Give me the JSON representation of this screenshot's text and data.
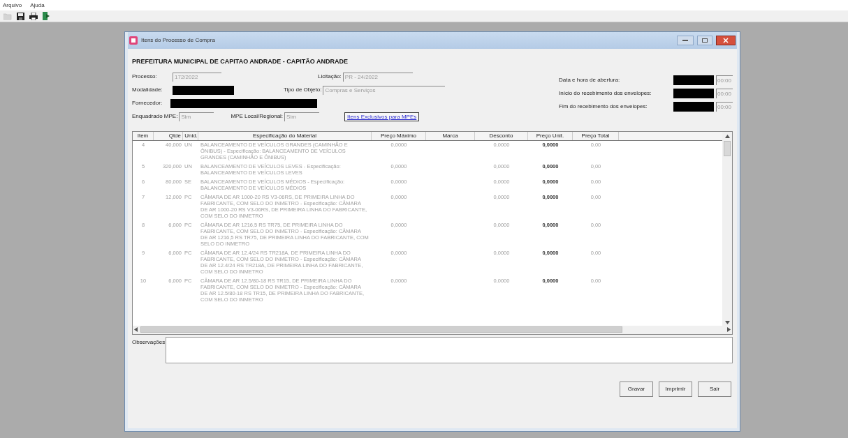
{
  "menu": [
    "Arquivo",
    "Ajuda"
  ],
  "toolbar": [
    {
      "kind": "open",
      "disabled": true
    },
    {
      "kind": "save",
      "disabled": false
    },
    {
      "kind": "print",
      "disabled": false
    },
    {
      "kind": "exit",
      "disabled": false
    }
  ],
  "window": {
    "title": "Itens do Processo de Compra"
  },
  "heading": "PREFEITURA MUNICIPAL DE CAPITAO ANDRADE - CAPITÃO ANDRADE",
  "fields": {
    "processo": {
      "label": "Processo:",
      "value": "172/2022"
    },
    "licitacao": {
      "label": "Licitação:",
      "value": "PR - 24/2022"
    },
    "modalidade": {
      "label": "Modalidade:",
      "redacted": true
    },
    "tipo_objeto": {
      "label": "Tipo de Objeto:",
      "value": "Compras e Serviços"
    },
    "fornecedor": {
      "label": "Fornecedor:",
      "redacted": true
    },
    "enquadrado_mpe": {
      "label": "Enquadrado MPE:",
      "value": "Sim"
    },
    "mpe_local": {
      "label": "MPE Local/Regional:",
      "value": "Sim"
    }
  },
  "mpe_button": "Itens Exclusivos para MPEs",
  "dates": [
    {
      "label": "Data e hora de abertura:",
      "redacted": true,
      "time": "00:00"
    },
    {
      "label": "Início do recebimento dos envelopes:",
      "redacted": true,
      "time": "00:00"
    },
    {
      "label": "Fim do recebimento dos envelopes:",
      "redacted": true,
      "time": "00:00"
    }
  ],
  "table": {
    "columns": [
      "Item",
      "Qtde",
      "Unid.",
      "Especificação do Material",
      "Preço Máximo",
      "Marca",
      "Desconto",
      "Preço Unit.",
      "Preço Total"
    ],
    "rows": [
      {
        "item": "4",
        "qtde": "40,000",
        "unid": "UN",
        "spec": "BALANCEAMENTO DE VEÍCULOS GRANDES (CAMINHÃO E ÔNIBUS) - Especificação: BALANCEAMENTO DE VEÍCULOS GRANDES (CAMINHÃO E ÔNIBUS)",
        "max": "0,0000",
        "marca": "",
        "desconto": "0,0000",
        "unit": "0,0000",
        "total": "0,00"
      },
      {
        "item": "5",
        "qtde": "320,000",
        "unid": "UN",
        "spec": "BALANCEAMENTO DE VEÍCULOS LEVES - Especificação: BALANCEAMENTO DE VEÍCULOS LEVES",
        "max": "0,0000",
        "marca": "",
        "desconto": "0,0000",
        "unit": "0,0000",
        "total": "0,00"
      },
      {
        "item": "6",
        "qtde": "80,000",
        "unid": "SE",
        "spec": "BALANCEAMENTO DE VEÍCULOS MÉDIOS - Especificação: BALANCEAMENTO DE VEÍCULOS MÉDIOS",
        "max": "0,0000",
        "marca": "",
        "desconto": "0,0000",
        "unit": "0,0000",
        "total": "0,00"
      },
      {
        "item": "7",
        "qtde": "12,000",
        "unid": "PC",
        "spec": "CÂMARA DE AR 1000-20 RS V3-06RS, DE PRIMEIRA LINHA DO FABRICANTE, COM SELO DO INMETRO - Especificação: CÂMARA DE AR 1000-20 RS V3-06RS, DE PRIMEIRA LINHA DO FABRICANTE, COM SELO DO INMETRO",
        "max": "0,0000",
        "marca": "",
        "desconto": "0,0000",
        "unit": "0,0000",
        "total": "0,00"
      },
      {
        "item": "8",
        "qtde": "6,000",
        "unid": "PC",
        "spec": "CÂMARA DE AR 1216,5 RS TR75, DE PRIMEIRA LINHA DO FABRICANTE, COM SELO DO INMETRO - Especificação: CÂMARA DE AR 1216,5 RS TR75, DE PRIMEIRA LINHA DO FABRICANTE, COM SELO DO INMETRO",
        "max": "0,0000",
        "marca": "",
        "desconto": "0,0000",
        "unit": "0,0000",
        "total": "0,00"
      },
      {
        "item": "9",
        "qtde": "6,000",
        "unid": "PC",
        "spec": "CÂMARA DE AR 12.4/24 RS TR218A, DE PRIMEIRA LINHA DO FABRICANTE, COM SELO DO INMETRO - Especificação: CÂMARA DE AR 12.4/24 RS TR218A, DE PRIMEIRA LINHA DO FABRICANTE, COM SELO DO INMETRO",
        "max": "0,0000",
        "marca": "",
        "desconto": "0,0000",
        "unit": "0,0000",
        "total": "0,00"
      },
      {
        "item": "10",
        "qtde": "6,000",
        "unid": "PC",
        "spec": "CÂMARA DE AR 12.5/80-18 RS TR15, DE PRIMEIRA LINHA DO FABRICANTE, COM SELO DO INMETRO - Especificação: CÂMARA DE AR 12.5/80-18 RS TR15, DE PRIMEIRA LINHA DO FABRICANTE, COM SELO DO INMETRO",
        "max": "0,0000",
        "marca": "",
        "desconto": "0,0000",
        "unit": "0,0000",
        "total": "0,00"
      }
    ]
  },
  "observacoes": {
    "label": "Observações:"
  },
  "buttons": [
    "Gravar",
    "Imprimir",
    "Sair"
  ]
}
